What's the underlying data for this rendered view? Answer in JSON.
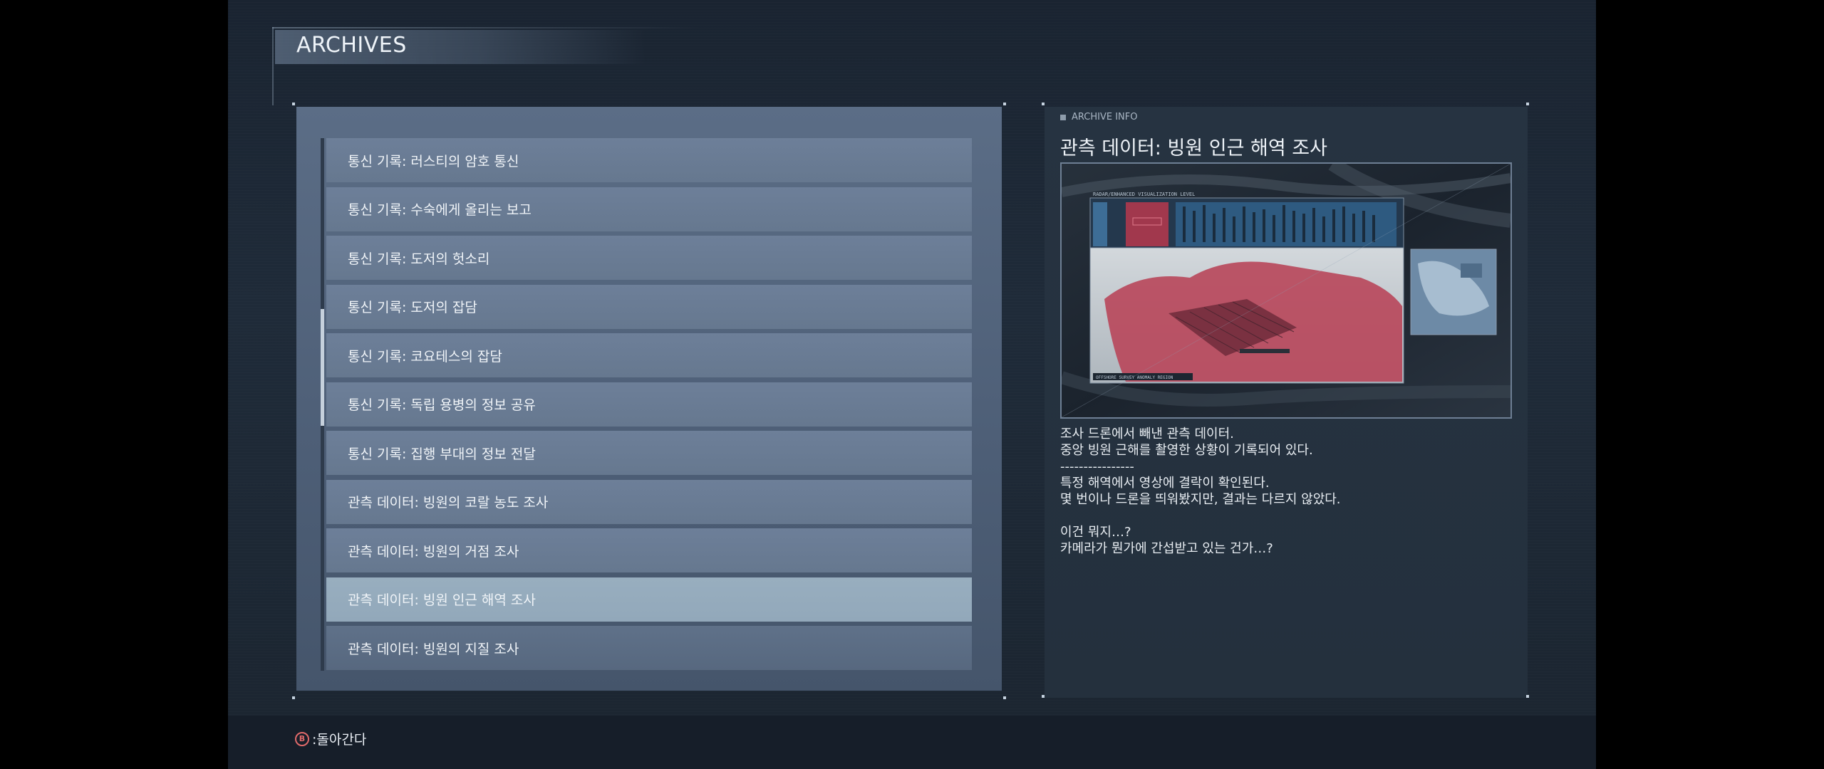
{
  "header": {
    "title": "ARCHIVES"
  },
  "archive_list": {
    "items": [
      {
        "label": "통신 기록: 러스티의 암호 통신"
      },
      {
        "label": "통신 기록: 수숙에게 올리는 보고"
      },
      {
        "label": "통신 기록: 도저의 헛소리"
      },
      {
        "label": "통신 기록: 도저의 잡담"
      },
      {
        "label": "통신 기록: 코요테스의 잡담"
      },
      {
        "label": "통신 기록: 독립 용병의 정보 공유"
      },
      {
        "label": "통신 기록: 집행 부대의 정보 전달"
      },
      {
        "label": "관측 데이터: 빙원의 코랄 농도 조사"
      },
      {
        "label": "관측 데이터: 빙원의 거점 조사"
      },
      {
        "label": "관측 데이터: 빙원 인근 해역 조사"
      },
      {
        "label": "관측 데이터: 빙원의 지질 조사"
      }
    ],
    "selected_index": 9
  },
  "info": {
    "tag": "ARCHIVE INFO",
    "title": "관측 데이터: 빙원 인근 해역 조사",
    "image": {
      "top_label": "RADAR/ENHANCED VISUALIZATION LEVEL",
      "bottom_label": "OFFSHORE SURVEY ANOMALY REGION",
      "colors": {
        "red": "#b8465a",
        "blue": "#3d6d96",
        "ice": "#c9d0d6"
      }
    },
    "description": [
      "조사 드론에서 빼낸 관측 데이터.",
      "중앙 빙원 근해를 촬영한 상황이 기록되어 있다.",
      "----------------",
      "특정 해역에서 영상에 결락이 확인된다.",
      "몇 번이나 드론을 띄워봤지만, 결과는 다르지 않았다.",
      "",
      "이건 뭐지…?",
      "카메라가 뭔가에 간섭받고 있는 건가…?"
    ]
  },
  "footer": {
    "button_glyph": "B",
    "back_label": ":돌아간다"
  },
  "colors": {
    "accent_button": "#e06a6a",
    "selected_item": "#98aebf",
    "list_item": "#6d7f99"
  }
}
